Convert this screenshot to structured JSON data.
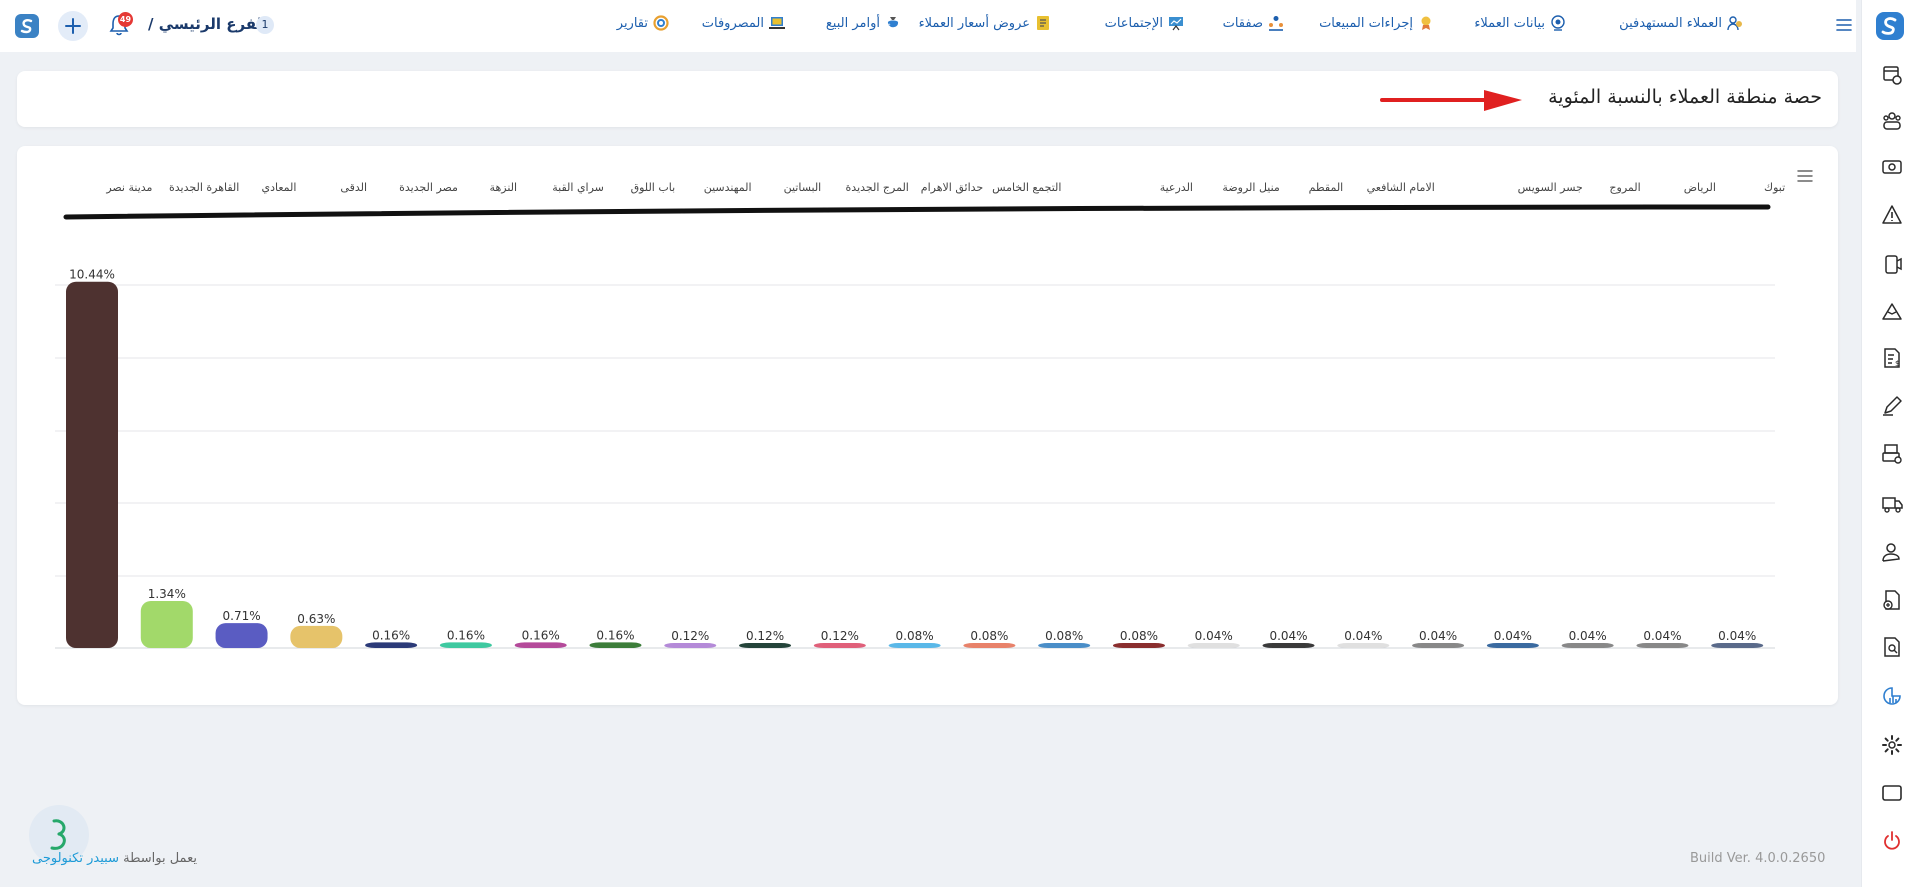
{
  "header": {
    "branch_name": "الفرع الرئيسي /",
    "branch_number": "1",
    "notification_count": "49",
    "nav": [
      {
        "label": "العملاء المستهدفين",
        "icon": "target-customers-icon",
        "color": "#1d5fae"
      },
      {
        "label": "بيانات العملاء",
        "icon": "customer-data-icon",
        "color": "#1d5fae"
      },
      {
        "label": "إجراءات المبيعات",
        "icon": "sales-actions-icon",
        "color": "#1d5fae"
      },
      {
        "label": "صفقات",
        "icon": "deals-icon",
        "color": "#1d5fae"
      },
      {
        "label": "الإجتماعات",
        "icon": "meetings-icon",
        "color": "#1d5fae"
      },
      {
        "label": "عروض أسعار العملاء",
        "icon": "quotes-icon",
        "color": "#1d5fae"
      },
      {
        "label": "أوامر البيع",
        "icon": "sales-orders-icon",
        "color": "#1d5fae"
      },
      {
        "label": "المصروفات",
        "icon": "expenses-icon",
        "color": "#1d5fae"
      },
      {
        "label": "تقارير",
        "icon": "reports-icon",
        "color": "#1d5fae"
      }
    ]
  },
  "page": {
    "title": "حصة منطقة العملاء بالنسبة المئوية"
  },
  "chart_data": {
    "type": "bar",
    "title": "",
    "xlabel": "",
    "ylabel": "",
    "ylim": [
      0,
      12
    ],
    "grid": true,
    "legend_position": "top",
    "categories": [
      "مدينة نصر",
      "القاهرة الجديدة",
      "المعادي",
      "الدقى",
      "مصر الجديدة",
      "النزهة",
      "سراي القبة",
      "باب اللوق",
      "المهندسين",
      "البساتين",
      "المرج الجديدة",
      "حدائق الاهرام",
      "التجمع الخامس",
      "",
      "الدرعية",
      "منيل الروضة",
      "المقطم",
      "الامام الشافعي",
      "",
      "جسر السويس",
      "المروج",
      "الرياض",
      "تبوك"
    ],
    "values": [
      10.44,
      1.34,
      0.71,
      0.63,
      0.16,
      0.16,
      0.16,
      0.16,
      0.12,
      0.12,
      0.12,
      0.08,
      0.08,
      0.08,
      0.08,
      0.04,
      0.04,
      0.04,
      0.04,
      0.04,
      0.04,
      0.04,
      0.04
    ],
    "labels": [
      "10.44%",
      "1.34%",
      "0.71%",
      "0.63%",
      "0.16%",
      "0.16%",
      "0.16%",
      "0.16%",
      "0.12%",
      "0.12%",
      "0.12%",
      "0.08%",
      "0.08%",
      "0.08%",
      "0.08%",
      "0.04%",
      "0.04%",
      "0.04%",
      "0.04%",
      "0.04%",
      "0.04%",
      "0.04%",
      "0.04%"
    ],
    "colors": [
      "#4e3230",
      "#a2d96a",
      "#5a5cc2",
      "#e6c36a",
      "#2b3a78",
      "#3ec9a0",
      "#b44a9a",
      "#3c7d3a",
      "#b48ad8",
      "#24443a",
      "#e0607a",
      "#5ab8e8",
      "#e8826a",
      "#4a8ec8",
      "#8a2e2e",
      "#e0e0e0",
      "#3a3a3a",
      "#e0e0e0",
      "#888888",
      "#3a6aa0",
      "#888888",
      "#888888",
      "#5a6a8a"
    ]
  },
  "sidebar": {
    "items": [
      {
        "icon": "dashboard-add-icon"
      },
      {
        "icon": "team-icon"
      },
      {
        "icon": "cash-icon"
      },
      {
        "icon": "warning-icon"
      },
      {
        "icon": "device-icon"
      },
      {
        "icon": "mountain-icon"
      },
      {
        "icon": "invoice-icon"
      },
      {
        "icon": "pen-icon"
      },
      {
        "icon": "printer-icon"
      },
      {
        "icon": "truck-icon"
      },
      {
        "icon": "user-settings-icon"
      },
      {
        "icon": "add-document-icon"
      },
      {
        "icon": "document-search-icon"
      },
      {
        "icon": "report-chart-icon"
      },
      {
        "icon": "gear-icon"
      },
      {
        "icon": "window-icon"
      },
      {
        "icon": "power-icon"
      }
    ]
  },
  "footer": {
    "powered_prefix": "يعمل بواسطة",
    "powered_brand": "سبيدر تكنولوجى",
    "build": "Build Ver. 4.0.0.2650"
  }
}
